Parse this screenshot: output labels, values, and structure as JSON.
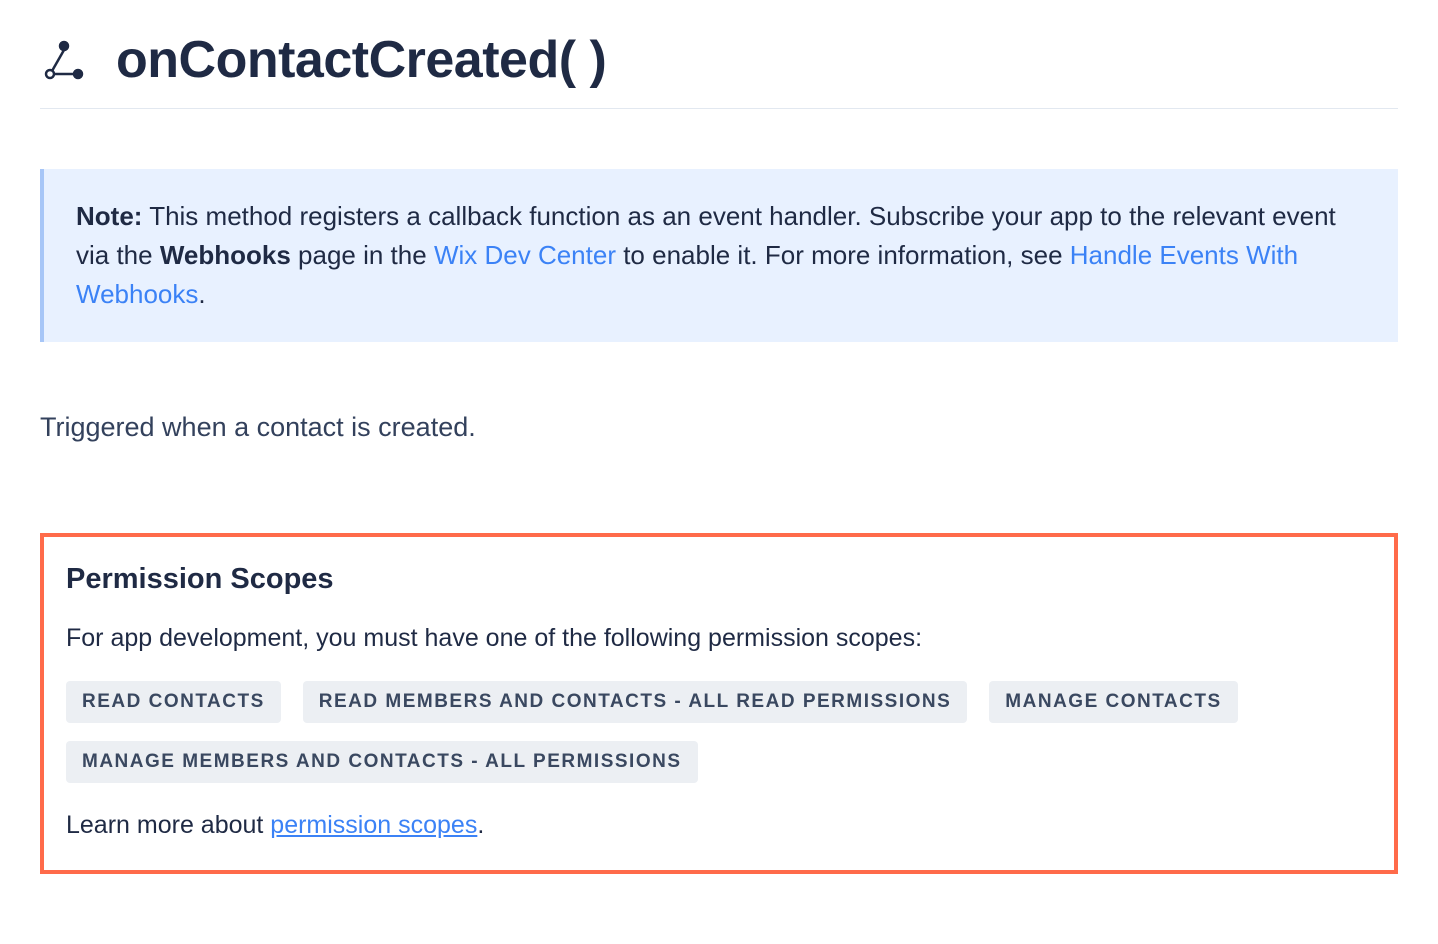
{
  "header": {
    "title": "onContactCreated( )"
  },
  "note": {
    "label": "Note:",
    "text_before_webhooks": " This method registers a callback function as an event handler. Subscribe your app to the relevant event via the ",
    "webhooks_bold": "Webhooks",
    "text_after_webhooks": " page in the ",
    "link_dev_center": "Wix Dev Center",
    "text_after_link1": " to enable it. For more information, see ",
    "link_webhooks_guide": "Handle Events With Webhooks",
    "text_end": "."
  },
  "description": "Triggered when a contact is created.",
  "permissions": {
    "title": "Permission Scopes",
    "desc": "For app development, you must have one of the following permission scopes:",
    "badges": [
      "READ CONTACTS",
      "READ MEMBERS AND CONTACTS - ALL READ PERMISSIONS",
      "MANAGE CONTACTS",
      "MANAGE MEMBERS AND CONTACTS - ALL PERMISSIONS"
    ],
    "learn_prefix": "Learn more about ",
    "learn_link": "permission scopes",
    "learn_suffix": "."
  }
}
